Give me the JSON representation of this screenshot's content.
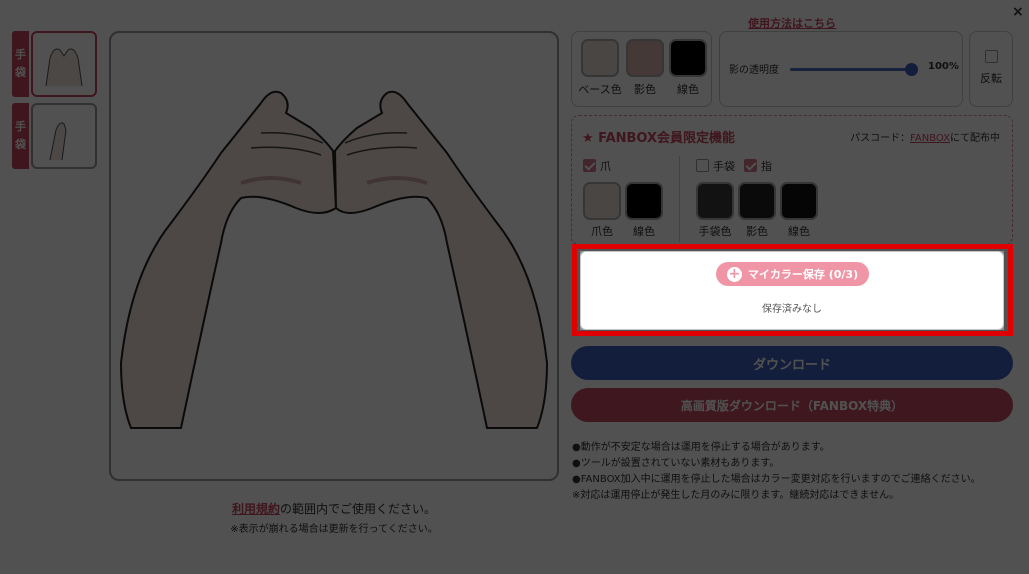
{
  "header": {
    "howto_link": "使用方法はこちら",
    "close_icon": "×"
  },
  "thumbnails": [
    {
      "tab": [
        "手",
        "袋"
      ],
      "selected": true
    },
    {
      "tab": [
        "手",
        "袋"
      ],
      "selected": false
    }
  ],
  "terms": {
    "link": "利用規約",
    "text": "の範囲内でご使用ください。",
    "note": "※表示が崩れる場合は更新を行ってください。"
  },
  "colors": {
    "base": {
      "label": "ベース色",
      "color": "#e9ddd4"
    },
    "shadow": {
      "label": "影色",
      "color": "#d6b3b0"
    },
    "line": {
      "label": "線色",
      "color": "#000000"
    }
  },
  "opacity": {
    "label": "影の透明度",
    "value": "100%"
  },
  "flip": {
    "label": "反転",
    "checked": false
  },
  "fanbox": {
    "title": "★ FANBOX会員限定機能",
    "pass_prefix": "パスコード：",
    "pass_link": "FANBOX",
    "pass_suffix": "にて配布中",
    "nail": {
      "label": "爪",
      "checked": true
    },
    "glove": {
      "label": "手袋",
      "checked": false
    },
    "finger": {
      "label": "指",
      "checked": true
    },
    "nail_colors": [
      {
        "label": "爪色",
        "color": "#e9ddd4"
      },
      {
        "label": "線色",
        "color": "#000000"
      }
    ],
    "glove_colors": [
      {
        "label": "手袋色",
        "color": "#3a3a3a"
      },
      {
        "label": "影色",
        "color": "#222222"
      },
      {
        "label": "線色",
        "color": "#111111"
      }
    ]
  },
  "mycolor": {
    "button": "マイカラー保存 (0/3)",
    "empty": "保存済みなし"
  },
  "buttons": {
    "download": "ダウンロード",
    "hq_download": "高画質版ダウンロード（FANBOX特典）"
  },
  "notes": [
    "●動作が不安定な場合は運用を停止する場合があります。",
    "●ツールが設置されていない素材もあります。",
    "●FANBOX加入中に運用を停止した場合はカラー変更対応を行いますのでご連絡ください。",
    "※対応は運用停止が発生した月のみに限ります。継続対応はできません。"
  ]
}
